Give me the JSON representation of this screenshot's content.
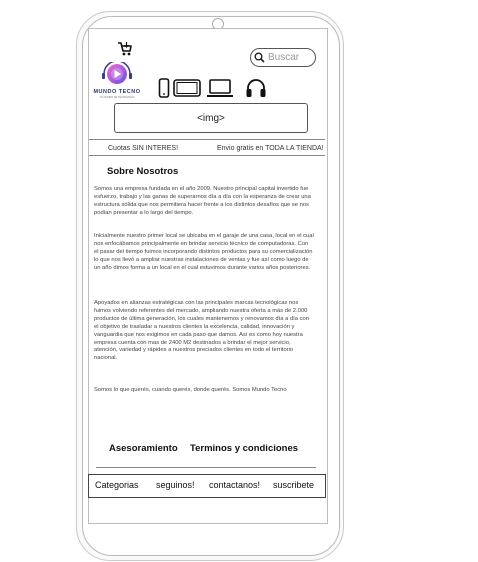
{
  "header": {
    "cart_icon": "cart-icon",
    "search_placeholder": "Buscar",
    "search_icon": "search-icon",
    "logo_text": "MUNDO TECNO",
    "logo_subtext": "TU MUNDO DE TECNOLOGÍA"
  },
  "categories": [
    {
      "icon": "smartphone-icon"
    },
    {
      "icon": "tablet-icon"
    },
    {
      "icon": "laptop-icon"
    },
    {
      "icon": "headphones-icon"
    }
  ],
  "banner": {
    "label": "<img>"
  },
  "promo": {
    "left": "Cuotas SIN INTERES!",
    "right": "Envio gratis en TODA LA TIENDA!"
  },
  "about": {
    "title": "Sobre Nosotros",
    "paragraphs": [
      "Somos una empresa fundada en el año 2009. Nuestro principal capital invertido fue esfuerzo, trabajo y las ganas de superarnos día a día con la esperanza de crear una estructura sólida que nos permitiera hacer frente a los distintos desafíos que se nos podían presentar a lo largo del tiempo.",
      "Inicialmente nuestro primer local se ubicaba en el garaje de una casa, local en el cual nos enfocábamos principalmente en brindar servicio técnico de computadoras.  Con el pasar del tiempo fuimos incorporando distintos productos para su comercialización lo que nos llevó a ampliar nuestras instalaciones de ventas y fue así como luego de un año dimos forma a un local en el cual estuvimos durante varios años posteriores.",
      "Apoyados en alianzas estratégicas con las principales marcas tecnológicas nos fuimos volviendo referentes del mercado, ampliando nuestra oferta a más de 2.000 productos de última generación, los cuales mantenemos y renovamos día a día con el objetivo de trasladar a nuestros clientes la excelencia, calidad, innovación y vanguardia que nos exigimos en cada paso que damos. Así es como hoy nuestra empresa cuenta con mas de 2400 M2 destinados a brindar el mejor servicio, atención, variedad y rápides a nuestros preciados clientes en todo el territorio nacional.",
      "Somos lo que querés, cuando querés, donde querés. Somos Mundo Tecno"
    ]
  },
  "footer_links": {
    "advice": "Asesoramiento",
    "terms": "Terminos y condiciones"
  },
  "bottom_nav": {
    "categories": "Categorias",
    "follow": "seguinos!",
    "contact": "contactanos!",
    "subscribe": "suscribete"
  }
}
